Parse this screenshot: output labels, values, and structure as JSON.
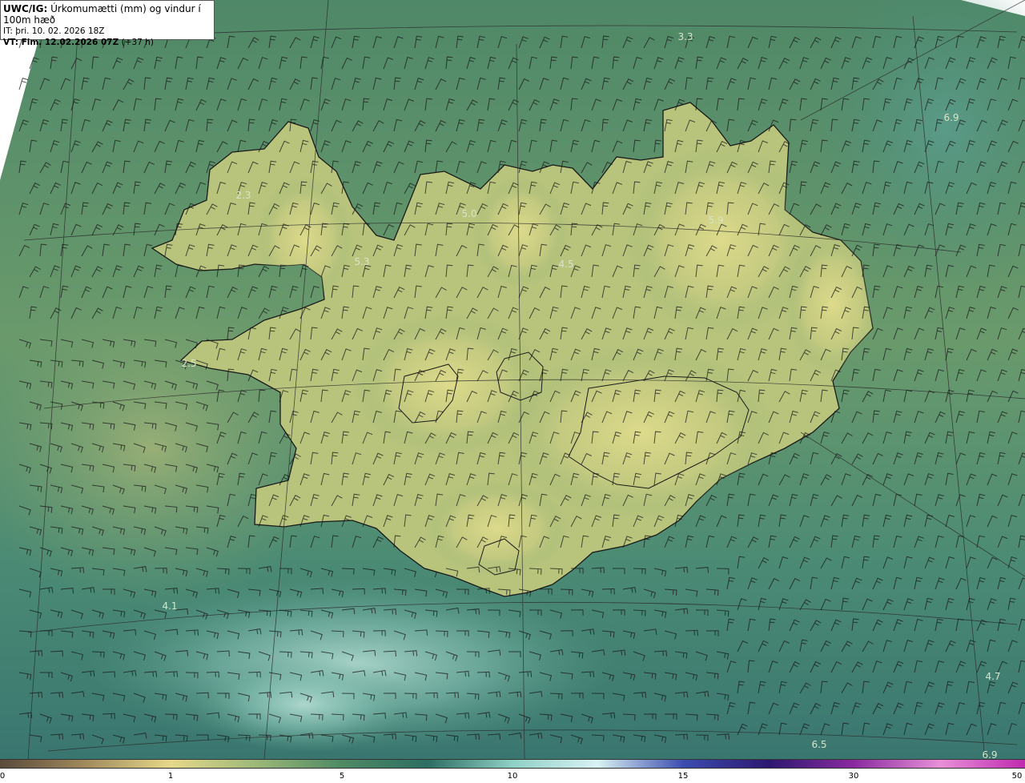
{
  "header": {
    "model": "UWC/IG:",
    "title": "Úrkomumætti (mm) og vindur í 100m hæð",
    "init_time": "IT: þri. 10. 02. 2026 18Z",
    "valid_label": "VT: Fim. 12.02.2026 07Z",
    "valid_offset": "(+37 h)"
  },
  "value_labels": [
    "3.3",
    "6.9",
    "2.3",
    "5.0",
    "5.9",
    "5.3",
    "4.5",
    "2.5",
    "4.1",
    "4.7",
    "6.5",
    "6.9"
  ],
  "colorbar": {
    "ticks": [
      "0",
      "1",
      "5",
      "10",
      "15",
      "30",
      "50"
    ],
    "colors": [
      "#5a4a3c",
      "#a08a5c",
      "#e6d88a",
      "#9cb878",
      "#4f8a64",
      "#2c6e62",
      "#8fd0c4",
      "#d8f2f2",
      "#3c4cb0",
      "#2c1870",
      "#8a2aa0",
      "#e890d8",
      "#c02ab0"
    ]
  },
  "colors": {
    "land_high": "#d8d888",
    "land_low": "#a8ba74",
    "sea_green": "#5f9670",
    "sea_teal": "#3f8074",
    "sea_light": "#8cc4bc",
    "coast": "#1a1a1a",
    "barb": "#1a1a1a"
  }
}
